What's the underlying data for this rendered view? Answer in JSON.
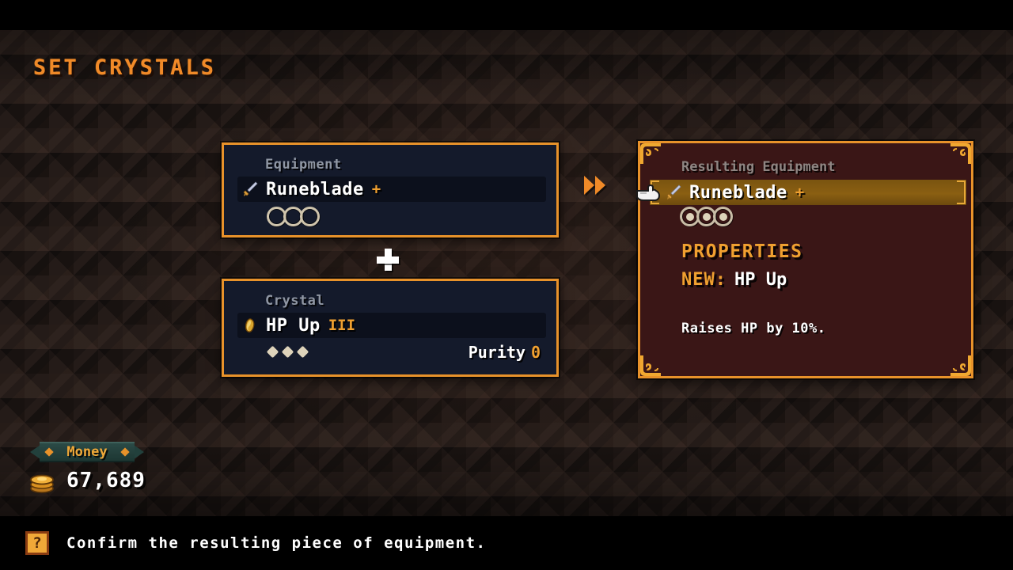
{
  "screen": {
    "title": "SET CRYSTALS"
  },
  "equipment_panel": {
    "label": "Equipment",
    "item_icon": "sword-icon",
    "item_name": "Runeblade",
    "item_suffix": "+",
    "sockets": {
      "count": 3,
      "filled": 0
    }
  },
  "combine_operator": "+",
  "crystal_panel": {
    "label": "Crystal",
    "item_icon": "gem-icon",
    "item_name": "HP Up",
    "item_rank": "III",
    "dots": 3,
    "purity_label": "Purity",
    "purity_value": "0"
  },
  "arrow": {
    "icon": "double-chevron-right-icon"
  },
  "result_panel": {
    "label": "Resulting Equipment",
    "item_icon": "sword-icon",
    "cursor_icon": "pointing-hand-cursor-icon",
    "item_name": "Runeblade",
    "item_suffix": "+",
    "sockets": {
      "count": 3,
      "filled": 3
    },
    "properties_heading": "PROPERTIES",
    "new_key": "NEW:",
    "new_value": "HP Up",
    "description": "Raises HP by 10%."
  },
  "money": {
    "label": "Money",
    "coin_icon": "coin-stack-icon",
    "amount": "67,689"
  },
  "hint": {
    "badge_icon": "question-mark-icon",
    "badge_glyph": "?",
    "text": "Confirm the resulting piece of equipment."
  },
  "colors": {
    "accent_orange": "#e8922a",
    "title_orange": "#f08a28",
    "panel_blue": "#141a2b",
    "panel_result_maroon": "#3a1616",
    "highlight_gold": "#8a5f12",
    "socket_beige": "#cfc4ac",
    "money_ribbon_teal": "#2b4a46",
    "background_brown": "#241b18"
  }
}
